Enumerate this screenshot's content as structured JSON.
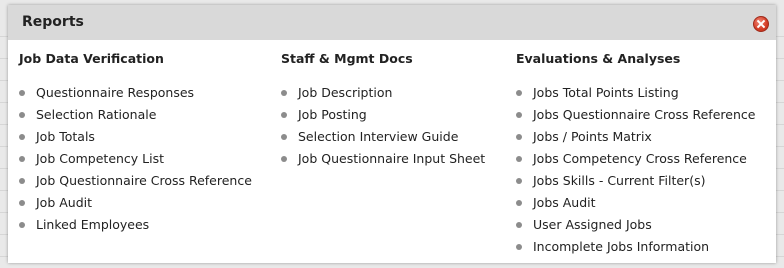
{
  "dialog": {
    "title": "Reports",
    "close_icon": "close-icon"
  },
  "columns": [
    {
      "heading": "Job Data Verification",
      "items": [
        "Questionnaire Responses",
        "Selection Rationale",
        "Job Totals",
        "Job Competency List",
        "Job Questionnaire Cross Reference",
        "Job Audit",
        "Linked Employees"
      ]
    },
    {
      "heading": "Staff & Mgmt Docs",
      "items": [
        "Job Description",
        "Job Posting",
        "Selection Interview Guide",
        "Job Questionnaire Input Sheet"
      ]
    },
    {
      "heading": "Evaluations & Analyses",
      "items": [
        "Jobs Total Points Listing",
        "Jobs Questionnaire Cross Reference",
        "Jobs / Points Matrix",
        "Jobs Competency Cross Reference",
        "Jobs Skills - Current Filter(s)",
        "Jobs Audit",
        "User Assigned Jobs",
        "Incomplete Jobs Information"
      ]
    }
  ],
  "colors": {
    "titlebar": "#d9d9d9",
    "bullet": "#8c8c8c",
    "close": "#d43c25"
  }
}
